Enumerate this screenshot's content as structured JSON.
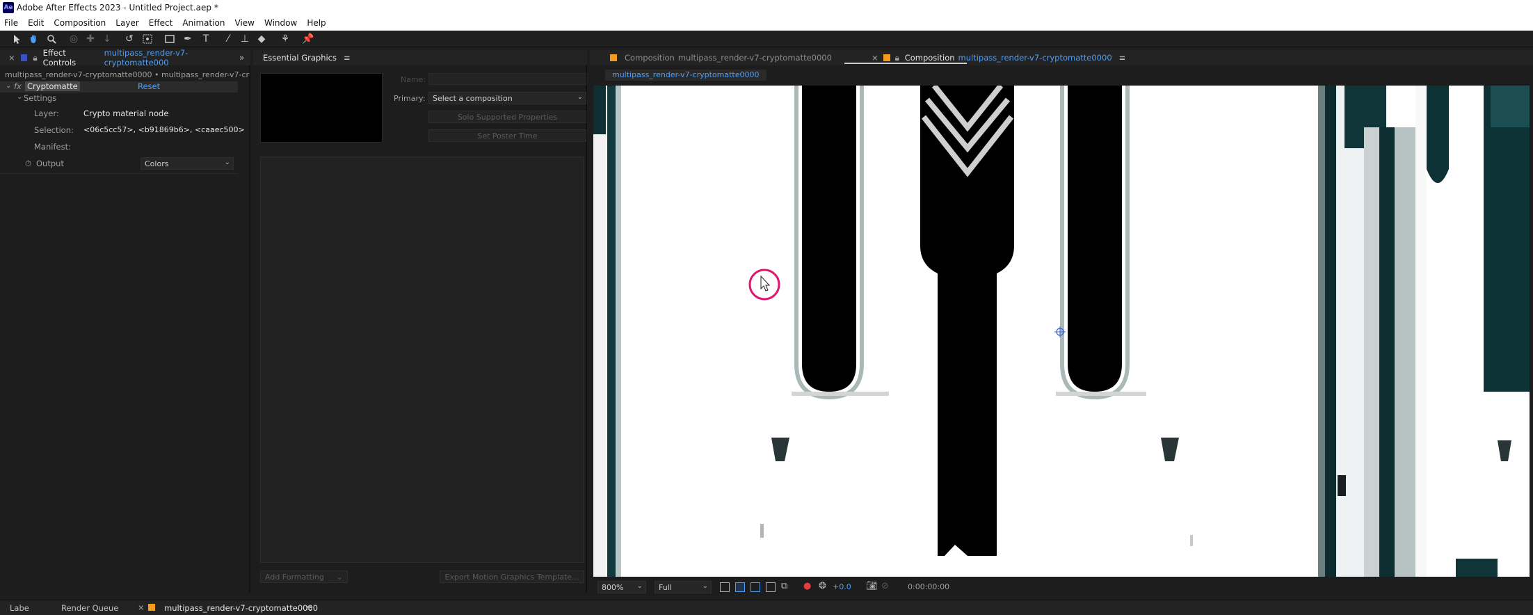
{
  "window": {
    "title": "Adobe After Effects 2023 - Untitled Project.aep *",
    "icon": "Ae"
  },
  "menu": [
    "File",
    "Edit",
    "Composition",
    "Layer",
    "Effect",
    "Animation",
    "View",
    "Window",
    "Help"
  ],
  "toolbar": {
    "tools": [
      "selection-tool-icon",
      "hand-tool-icon",
      "zoom-tool-icon",
      "orbit-camera-icon",
      "pan-camera-icon",
      "dolly-camera-icon",
      "rotation-tool-icon",
      "pan-behind-icon",
      "rectangle-tool-icon",
      "pen-tool-icon",
      "type-tool-icon",
      "brush-tool-icon",
      "clone-stamp-icon",
      "eraser-tool-icon",
      "roto-brush-icon",
      "puppet-pin-icon"
    ]
  },
  "effect_controls": {
    "tab_label": "Effect Controls",
    "tab_target": "multipass_render-v7-cryptomatte000",
    "path": "multipass_render-v7-cryptomatte0000 • multipass_render-v7-cryptoma",
    "effect_name": "Cryptomatte",
    "reset": "Reset",
    "settings": "Settings",
    "layer_label": "Layer:",
    "layer_value": "Crypto material node",
    "selection_label": "Selection:",
    "selection_value": "<06c5cc57>, <b91869b6>, <caaec500>",
    "manifest_label": "Manifest:",
    "output_label": "Output",
    "output_value": "Colors"
  },
  "essential_graphics": {
    "title": "Essential Graphics",
    "name_label": "Name:",
    "primary_label": "Primary:",
    "primary_value": "Select a composition",
    "solo_button": "Solo Supported Properties",
    "poster_button": "Set Poster Time",
    "add_formatting": "Add Formatting",
    "export_button": "Export Motion Graphics Template..."
  },
  "composition": {
    "tab1_prefix": "Composition",
    "tab1_name": "multipass_render-v7-cryptomatte0000",
    "tab2_prefix": "Composition",
    "tab2_name": "multipass_render-v7-cryptomatte0000",
    "subtab": "multipass_render-v7-cryptomatte0000",
    "zoom": "800%",
    "resolution": "Full",
    "exposure": "+0.0",
    "timecode": "0:00:00:00"
  },
  "bottom": {
    "tab1": "Labe",
    "tab2": "Render Queue",
    "tab3": "multipass_render-v7-cryptomatte0000"
  },
  "colors": {
    "accent_blue": "#4f9ef7",
    "highlight_pink": "#e0166f",
    "orange": "#f59b1b"
  }
}
